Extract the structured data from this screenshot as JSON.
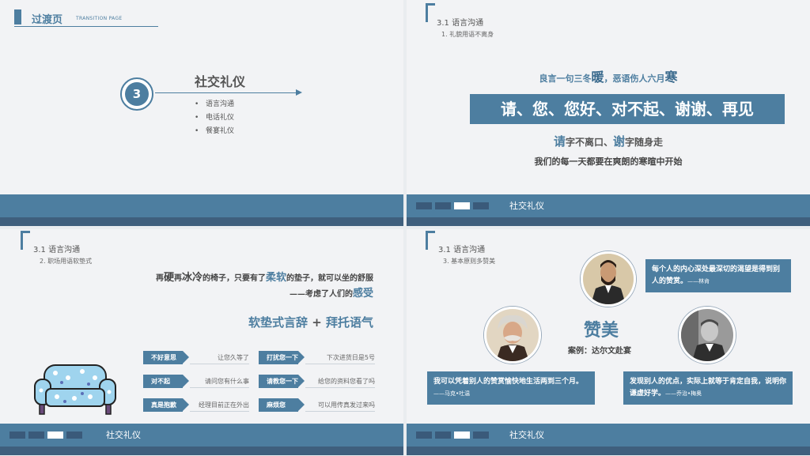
{
  "common": {
    "footer_label": "社交礼仪",
    "section_title": "3.1  语言沟通"
  },
  "slide1": {
    "title": "过渡页",
    "subtitle": "TRANSITION PAGE",
    "number": "3",
    "heading": "社交礼仪",
    "items": [
      "语言沟通",
      "电话礼仪",
      "餐宴礼仪"
    ],
    "bullet": "•"
  },
  "slide2": {
    "subtitle": "1. 礼貌用语不离身",
    "quote_a": "良言一句三冬",
    "quote_warm": "暖",
    "quote_b": "，恶语伤人六月",
    "quote_cold": "寒",
    "box_text": "请、您、您好、对不起、谢谢、再见",
    "line2_please": "请",
    "line2_a": "字不离口、",
    "line2_thanks": "谢",
    "line2_b": "字随身走",
    "line3": "我们的每一天都要在爽朗的寒暄中开始"
  },
  "slide3": {
    "subtitle": "2. 职场用语软垫式",
    "quote_1": "再",
    "quote_hard": "硬",
    "quote_2": "再",
    "quote_cold": "冰冷",
    "quote_3": "的椅子，只要有了",
    "quote_soft": "柔软",
    "quote_4": "的垫子，就可以坐的舒服",
    "author_a": "——考虑了人们的",
    "author_feel": "感受",
    "formula_a": "软垫式言辞",
    "formula_plus": " + ",
    "formula_b": "拜托语气",
    "tags": [
      {
        "label": "不好意思",
        "text": "让您久等了"
      },
      {
        "label": "对不起",
        "text": "请问您有什么事"
      },
      {
        "label": "真是抱歉",
        "text": "经理目前正在外出"
      },
      {
        "label": "打扰您一下",
        "text": "下次进货日是5号"
      },
      {
        "label": "请教您一下",
        "text": "给您的资料您看了吗"
      },
      {
        "label": "麻烦您",
        "text": "可以用传真发过来吗"
      }
    ]
  },
  "slide4": {
    "subtitle": "3. 基本原则多赞美",
    "heading": "赞美",
    "case": "案例：达尔文赴宴",
    "quote_lincoln": "每个人的内心深处最深切的渴望是得到别人的赞赏。",
    "author_lincoln": "——林肯",
    "quote_twain": "我可以凭着别人的赞赏愉快地生活两到三个月。",
    "author_twain": "——马克•吐温",
    "quote_james": "发现别人的优点，实际上就等于肯定自我，说明你谦虚好学。",
    "author_james": "——乔治•梅奥"
  },
  "colors": {
    "primary": "#4d7ea0",
    "dark": "#3f5f7d",
    "background": "#f2f3f5"
  }
}
